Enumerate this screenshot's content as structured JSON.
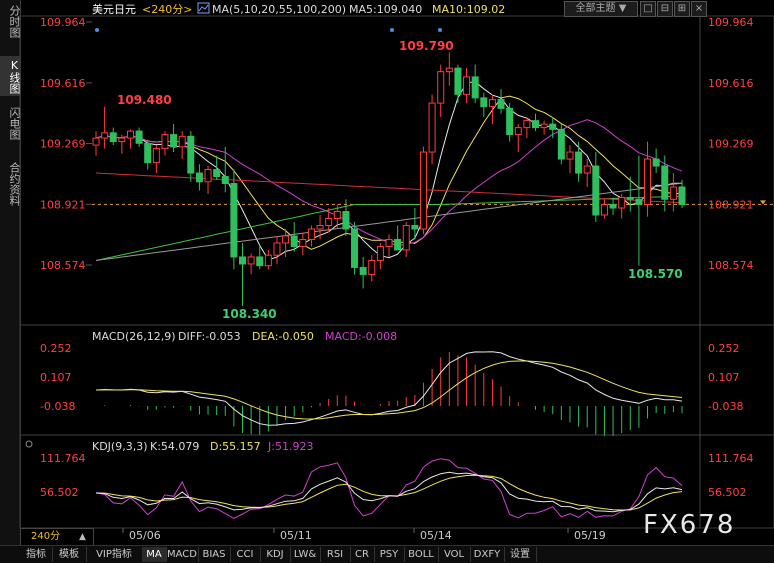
{
  "left_tabs": [
    "分时图",
    "K线图",
    "闪电图",
    "合约资料"
  ],
  "left_active": 1,
  "header": {
    "symbol": "美元日元",
    "period": "<240分>",
    "ma_label": "MA(5,10,20,55,100,200)",
    "ma5": "MA5:109.040",
    "ma10": "MA10:109.02",
    "theme": "全部主题",
    "theme_arrow": "▼"
  },
  "price_axis": [
    "109.964",
    "109.616",
    "109.269",
    "108.921",
    "108.574"
  ],
  "annotations": {
    "high": "109.790",
    "left_high": "109.480",
    "low": "108.340",
    "right_low": "108.570"
  },
  "macd": {
    "label": "MACD(26,12,9)",
    "diff": "DIFF:-0.053",
    "dea": "DEA:-0.050",
    "macd": "MACD:-0.008",
    "axis": [
      "0.252",
      "0.107",
      "-0.038"
    ]
  },
  "kdj": {
    "label": "KDJ(9,3,3)",
    "k": "K:54.079",
    "d": "D:55.157",
    "j": "J:51.923",
    "axis": [
      "111.764",
      "56.502"
    ]
  },
  "dates": [
    "05/06",
    "05/11",
    "05/14",
    "05/19"
  ],
  "period_box": "240分",
  "period_arrow": "▲",
  "bottom_tabs": [
    "指标",
    "模板",
    "VIP指标",
    "MA",
    "MACD",
    "BIAS",
    "CCI",
    "KDJ",
    "LW&",
    "RSI",
    "CR",
    "PSY",
    "BOLL",
    "VOL",
    "DXFY",
    "设置"
  ],
  "bottom_active": 3,
  "watermark": "FX678",
  "colors": {
    "up": "#ff3b3b",
    "down": "#2fbf5f",
    "ma5": "#e8e8e8",
    "ma10": "#f0e060",
    "ma20": "#d040d0",
    "ma55": "#40c040",
    "ma100": "#d03030",
    "ma200": "#999999",
    "axis_text": "#ff4040"
  },
  "chart_data": {
    "type": "candlestick",
    "title": "美元日元 <240分>",
    "ylim": [
      108.3,
      110.0
    ],
    "current_price": 108.921,
    "candles": [
      [
        109.26,
        109.34,
        109.2,
        109.3
      ],
      [
        109.3,
        109.48,
        109.24,
        109.33
      ],
      [
        109.33,
        109.36,
        109.26,
        109.28
      ],
      [
        109.28,
        109.32,
        109.21,
        109.3
      ],
      [
        109.3,
        109.35,
        109.24,
        109.34
      ],
      [
        109.34,
        109.36,
        109.25,
        109.27
      ],
      [
        109.27,
        109.29,
        109.12,
        109.16
      ],
      [
        109.16,
        109.26,
        109.1,
        109.24
      ],
      [
        109.24,
        109.34,
        109.2,
        109.32
      ],
      [
        109.32,
        109.38,
        109.22,
        109.25
      ],
      [
        109.25,
        109.34,
        109.18,
        109.31
      ],
      [
        109.31,
        109.34,
        109.05,
        109.1
      ],
      [
        109.1,
        109.15,
        109.0,
        109.05
      ],
      [
        109.05,
        109.14,
        108.98,
        109.12
      ],
      [
        109.12,
        109.2,
        109.06,
        109.08
      ],
      [
        109.08,
        109.25,
        108.99,
        109.04
      ],
      [
        109.04,
        109.12,
        108.55,
        108.62
      ],
      [
        108.62,
        108.7,
        108.34,
        108.58
      ],
      [
        108.58,
        108.64,
        108.52,
        108.62
      ],
      [
        108.62,
        108.68,
        108.55,
        108.57
      ],
      [
        108.57,
        108.66,
        108.55,
        108.63
      ],
      [
        108.63,
        108.74,
        108.58,
        108.7
      ],
      [
        108.7,
        108.78,
        108.62,
        108.74
      ],
      [
        108.74,
        108.82,
        108.65,
        108.68
      ],
      [
        108.68,
        108.76,
        108.63,
        108.72
      ],
      [
        108.72,
        108.8,
        108.68,
        108.78
      ],
      [
        108.78,
        108.86,
        108.72,
        108.8
      ],
      [
        108.8,
        108.9,
        108.76,
        108.84
      ],
      [
        108.84,
        108.92,
        108.78,
        108.88
      ],
      [
        108.88,
        108.95,
        108.74,
        108.78
      ],
      [
        108.78,
        108.82,
        108.52,
        108.56
      ],
      [
        108.56,
        108.62,
        108.44,
        108.52
      ],
      [
        108.52,
        108.63,
        108.48,
        108.6
      ],
      [
        108.6,
        108.7,
        108.55,
        108.68
      ],
      [
        108.68,
        108.75,
        108.62,
        108.72
      ],
      [
        108.72,
        108.8,
        108.66,
        108.66
      ],
      [
        108.66,
        108.82,
        108.62,
        108.8
      ],
      [
        108.8,
        108.9,
        108.72,
        108.78
      ],
      [
        108.78,
        109.25,
        108.75,
        109.22
      ],
      [
        109.22,
        109.55,
        109.15,
        109.5
      ],
      [
        109.5,
        109.72,
        109.42,
        109.68
      ],
      [
        109.68,
        109.79,
        109.6,
        109.7
      ],
      [
        109.7,
        109.72,
        109.5,
        109.55
      ],
      [
        109.55,
        109.7,
        109.5,
        109.65
      ],
      [
        109.65,
        109.72,
        109.5,
        109.53
      ],
      [
        109.53,
        109.56,
        109.42,
        109.48
      ],
      [
        109.48,
        109.55,
        109.38,
        109.52
      ],
      [
        109.52,
        109.58,
        109.44,
        109.47
      ],
      [
        109.47,
        109.5,
        109.28,
        109.32
      ],
      [
        109.32,
        109.38,
        109.22,
        109.36
      ],
      [
        109.36,
        109.42,
        109.3,
        109.4
      ],
      [
        109.4,
        109.44,
        109.34,
        109.36
      ],
      [
        109.36,
        109.4,
        109.32,
        109.38
      ],
      [
        109.38,
        109.42,
        109.3,
        109.35
      ],
      [
        109.35,
        109.38,
        109.15,
        109.18
      ],
      [
        109.18,
        109.26,
        109.1,
        109.22
      ],
      [
        109.22,
        109.28,
        109.05,
        109.1
      ],
      [
        109.1,
        109.18,
        109.02,
        109.14
      ],
      [
        109.14,
        109.22,
        108.82,
        108.86
      ],
      [
        108.86,
        108.95,
        108.84,
        108.92
      ],
      [
        108.92,
        108.96,
        108.86,
        108.9
      ],
      [
        108.9,
        108.98,
        108.84,
        108.96
      ],
      [
        108.96,
        109.08,
        108.88,
        108.95
      ],
      [
        108.95,
        109.2,
        108.57,
        108.92
      ],
      [
        108.92,
        109.28,
        108.85,
        109.18
      ],
      [
        109.18,
        109.24,
        109.1,
        109.14
      ],
      [
        109.14,
        109.2,
        108.88,
        108.95
      ],
      [
        108.95,
        109.1,
        108.88,
        109.02
      ],
      [
        109.02,
        109.06,
        108.9,
        108.92
      ]
    ],
    "macd_axis": [
      0.252,
      0.107,
      -0.038
    ],
    "kdj_axis": [
      111.764,
      56.502
    ]
  }
}
